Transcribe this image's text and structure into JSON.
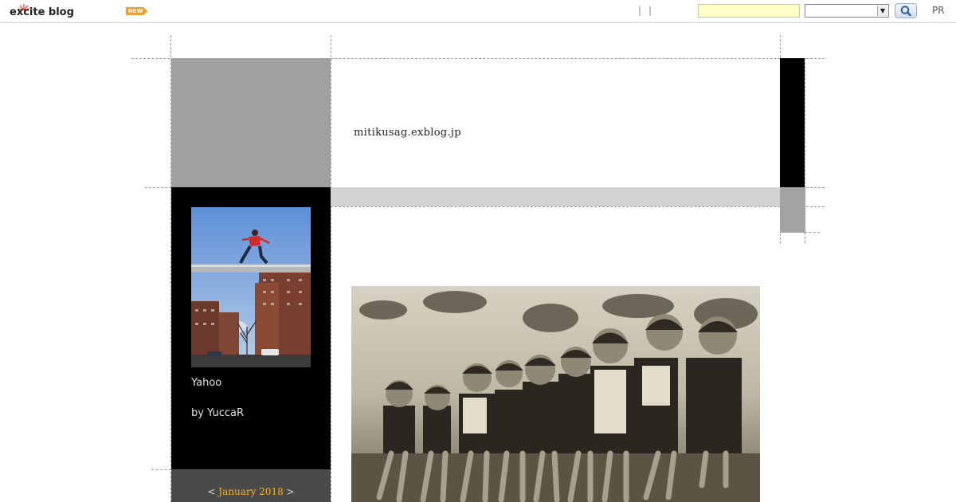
{
  "header": {
    "logo_text": "excite blog",
    "new_badge": "NEW",
    "separators": [
      "|",
      "|"
    ],
    "search": {
      "value": "",
      "select_value": ""
    },
    "pr_label": "PR"
  },
  "blog": {
    "title": "mitikusag.exblog.jp"
  },
  "profile": {
    "name": "Yahoo",
    "by": "by YuccaR"
  },
  "calendar": {
    "prev": "<",
    "month": "January 2018",
    "next": ">"
  },
  "colors": {
    "search_bg": "#ffffc8",
    "sidebar_bg": "#000000",
    "header_gray": "#a0a0a0",
    "band_gray": "#d2d2d2",
    "calendar_bg": "#4a4a4a",
    "calendar_link": "#f0b030",
    "badge": "#e8a13a"
  },
  "icons": {
    "search_button": "magnifier-icon",
    "select_arrow": "dropdown-arrow-icon"
  }
}
